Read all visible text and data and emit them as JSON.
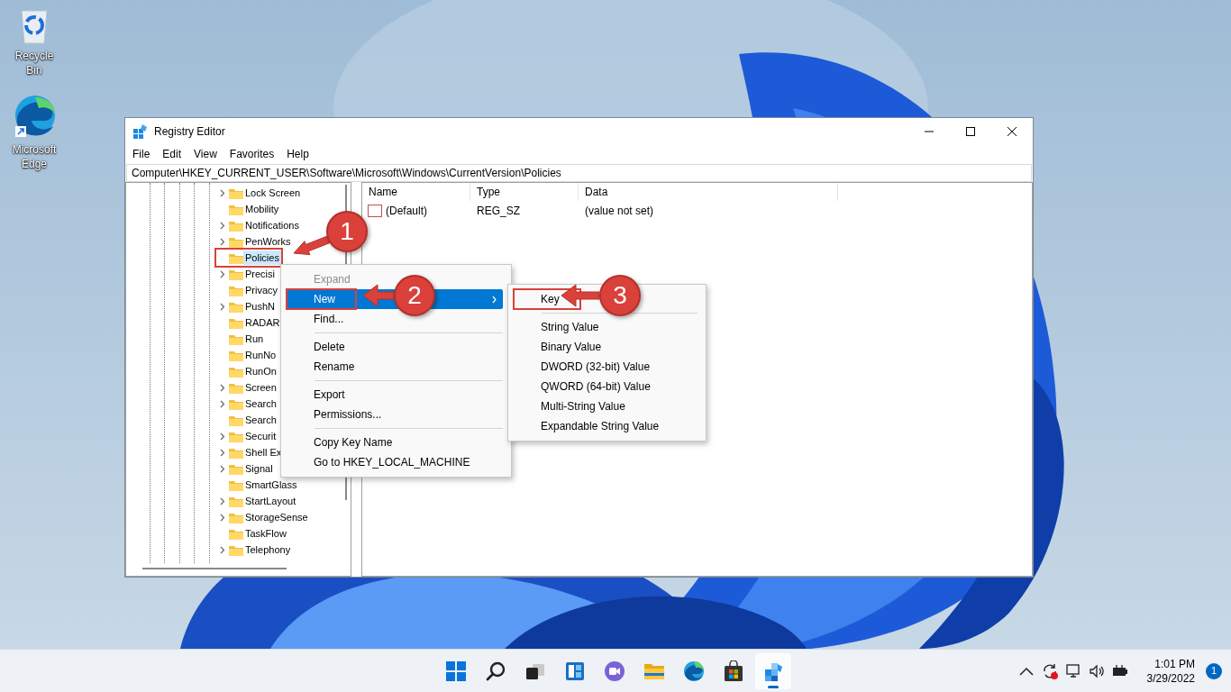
{
  "desktop_icons": [
    {
      "kind": "recycle",
      "label": "Recycle Bin"
    },
    {
      "kind": "edge",
      "label": "Microsoft Edge"
    }
  ],
  "window": {
    "title": "Registry Editor",
    "menu": [
      "File",
      "Edit",
      "View",
      "Favorites",
      "Help"
    ],
    "address": "Computer\\HKEY_CURRENT_USER\\Software\\Microsoft\\Windows\\CurrentVersion\\Policies",
    "tree": [
      {
        "label": "Lock Screen",
        "expandable": true,
        "selected": false,
        "annotated": false
      },
      {
        "label": "Mobility",
        "expandable": false,
        "selected": false,
        "annotated": false
      },
      {
        "label": "Notifications",
        "expandable": true,
        "selected": false,
        "annotated": false
      },
      {
        "label": "PenWorks",
        "expandable": true,
        "selected": false,
        "annotated": false
      },
      {
        "label": "Policies",
        "expandable": false,
        "selected": true,
        "annotated": true
      },
      {
        "label": "Precisi",
        "expandable": true,
        "selected": false,
        "annotated": false
      },
      {
        "label": "Privacy",
        "expandable": false,
        "selected": false,
        "annotated": false
      },
      {
        "label": "PushN",
        "expandable": true,
        "selected": false,
        "annotated": false
      },
      {
        "label": "RADAR",
        "expandable": false,
        "selected": false,
        "annotated": false
      },
      {
        "label": "Run",
        "expandable": false,
        "selected": false,
        "annotated": false
      },
      {
        "label": "RunNo",
        "expandable": false,
        "selected": false,
        "annotated": false
      },
      {
        "label": "RunOn",
        "expandable": false,
        "selected": false,
        "annotated": false
      },
      {
        "label": "Screen",
        "expandable": true,
        "selected": false,
        "annotated": false
      },
      {
        "label": "Search",
        "expandable": true,
        "selected": false,
        "annotated": false
      },
      {
        "label": "Search",
        "expandable": false,
        "selected": false,
        "annotated": false
      },
      {
        "label": "Securit",
        "expandable": true,
        "selected": false,
        "annotated": false
      },
      {
        "label": "Shell Ex",
        "expandable": true,
        "selected": false,
        "annotated": false
      },
      {
        "label": "Signal",
        "expandable": true,
        "selected": false,
        "annotated": false
      },
      {
        "label": "SmartGlass",
        "expandable": false,
        "selected": false,
        "annotated": false
      },
      {
        "label": "StartLayout",
        "expandable": true,
        "selected": false,
        "annotated": false
      },
      {
        "label": "StorageSense",
        "expandable": true,
        "selected": false,
        "annotated": false
      },
      {
        "label": "TaskFlow",
        "expandable": false,
        "selected": false,
        "annotated": false
      },
      {
        "label": "Telephony",
        "expandable": true,
        "selected": false,
        "annotated": false
      }
    ],
    "columns": [
      "Name",
      "Type",
      "Data"
    ],
    "values": [
      {
        "name": "(Default)",
        "type": "REG_SZ",
        "data": "(value not set)"
      }
    ]
  },
  "context_menu": {
    "items": [
      {
        "kind": "item",
        "label": "Expand",
        "disabled": true,
        "selected": false,
        "submenu": false,
        "annotated": false
      },
      {
        "kind": "item",
        "label": "New",
        "disabled": false,
        "selected": true,
        "submenu": true,
        "annotated": true
      },
      {
        "kind": "item",
        "label": "Find...",
        "disabled": false,
        "selected": false,
        "submenu": false,
        "annotated": false
      },
      {
        "kind": "separator"
      },
      {
        "kind": "item",
        "label": "Delete",
        "disabled": false,
        "selected": false,
        "submenu": false,
        "annotated": false
      },
      {
        "kind": "item",
        "label": "Rename",
        "disabled": false,
        "selected": false,
        "submenu": false,
        "annotated": false
      },
      {
        "kind": "separator"
      },
      {
        "kind": "item",
        "label": "Export",
        "disabled": false,
        "selected": false,
        "submenu": false,
        "annotated": false
      },
      {
        "kind": "item",
        "label": "Permissions...",
        "disabled": false,
        "selected": false,
        "submenu": false,
        "annotated": false
      },
      {
        "kind": "separator"
      },
      {
        "kind": "item",
        "label": "Copy Key Name",
        "disabled": false,
        "selected": false,
        "submenu": false,
        "annotated": false
      },
      {
        "kind": "item",
        "label": "Go to HKEY_LOCAL_MACHINE",
        "disabled": false,
        "selected": false,
        "submenu": false,
        "annotated": false
      }
    ]
  },
  "submenu": {
    "items": [
      {
        "kind": "item",
        "label": "Key",
        "disabled": false,
        "selected": false,
        "submenu": false,
        "annotated": true
      },
      {
        "kind": "separator"
      },
      {
        "kind": "item",
        "label": "String Value",
        "disabled": false,
        "selected": false,
        "submenu": false,
        "annotated": false
      },
      {
        "kind": "item",
        "label": "Binary Value",
        "disabled": false,
        "selected": false,
        "submenu": false,
        "annotated": false
      },
      {
        "kind": "item",
        "label": "DWORD (32-bit) Value",
        "disabled": false,
        "selected": false,
        "submenu": false,
        "annotated": false
      },
      {
        "kind": "item",
        "label": "QWORD (64-bit) Value",
        "disabled": false,
        "selected": false,
        "submenu": false,
        "annotated": false
      },
      {
        "kind": "item",
        "label": "Multi-String Value",
        "disabled": false,
        "selected": false,
        "submenu": false,
        "annotated": false
      },
      {
        "kind": "item",
        "label": "Expandable String Value",
        "disabled": false,
        "selected": false,
        "submenu": false,
        "annotated": false
      }
    ]
  },
  "callouts": [
    "1",
    "2",
    "3"
  ],
  "taskbar": {
    "apps": [
      {
        "kind": "start",
        "active": false
      },
      {
        "kind": "search",
        "active": false
      },
      {
        "kind": "taskview",
        "active": false
      },
      {
        "kind": "widgets",
        "active": false
      },
      {
        "kind": "chat",
        "active": false
      },
      {
        "kind": "explorer",
        "active": false
      },
      {
        "kind": "edge",
        "active": false
      },
      {
        "kind": "store",
        "active": false
      },
      {
        "kind": "regedit",
        "active": true
      }
    ],
    "time": "1:01 PM",
    "date": "3/29/2022",
    "notifications": "1"
  }
}
